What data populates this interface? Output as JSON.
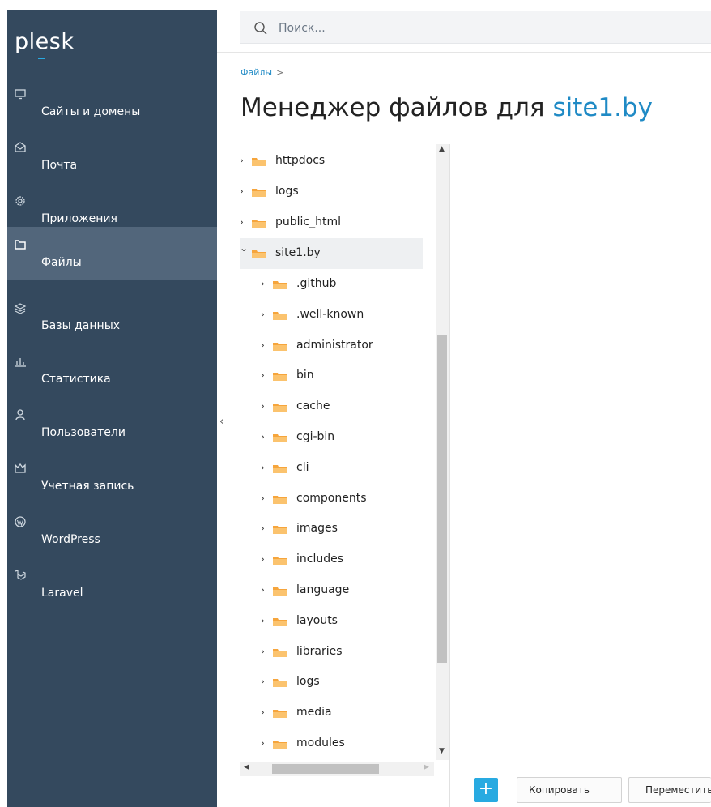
{
  "app": {
    "logo": "plesk"
  },
  "search": {
    "placeholder": "Поиск..."
  },
  "sidebar": {
    "items": [
      {
        "label": "Сайты и домены",
        "icon": "monitor-icon"
      },
      {
        "label": "Почта",
        "icon": "mail-icon"
      },
      {
        "label": "Приложения",
        "icon": "gear-icon"
      },
      {
        "label": "Файлы",
        "icon": "folder-icon",
        "active": true
      },
      {
        "label": "Базы данных",
        "icon": "database-icon"
      },
      {
        "label": "Статистика",
        "icon": "bar-chart-icon"
      },
      {
        "label": "Пользователи",
        "icon": "user-icon"
      },
      {
        "label": "Учетная запись",
        "icon": "account-icon"
      },
      {
        "label": "WordPress",
        "icon": "wordpress-icon"
      },
      {
        "label": "Laravel",
        "icon": "laravel-icon"
      }
    ]
  },
  "breadcrumb": {
    "item": "Файлы",
    "separator": ">"
  },
  "page": {
    "title_prefix": "Менеджер файлов для ",
    "title_domain": "site1.by"
  },
  "tree": {
    "root": [
      {
        "label": "httpdocs",
        "expanded": false
      },
      {
        "label": "logs",
        "expanded": false
      },
      {
        "label": "public_html",
        "expanded": false
      },
      {
        "label": "site1.by",
        "expanded": true,
        "selected": true
      }
    ],
    "children": [
      {
        "label": ".github"
      },
      {
        "label": ".well-known"
      },
      {
        "label": "administrator"
      },
      {
        "label": "bin"
      },
      {
        "label": "cache"
      },
      {
        "label": "cgi-bin"
      },
      {
        "label": "cli"
      },
      {
        "label": "components"
      },
      {
        "label": "images"
      },
      {
        "label": "includes"
      },
      {
        "label": "language"
      },
      {
        "label": "layouts"
      },
      {
        "label": "libraries"
      },
      {
        "label": "logs"
      },
      {
        "label": "media"
      },
      {
        "label": "modules"
      }
    ]
  },
  "toolbar": {
    "add_label": "+",
    "copy_label": "Копировать",
    "move_label": "Переместить"
  },
  "colors": {
    "sidebar_bg": "#34495e",
    "sidebar_active": "#52667b",
    "accent": "#28aae1",
    "folder": "#f6a53c"
  }
}
